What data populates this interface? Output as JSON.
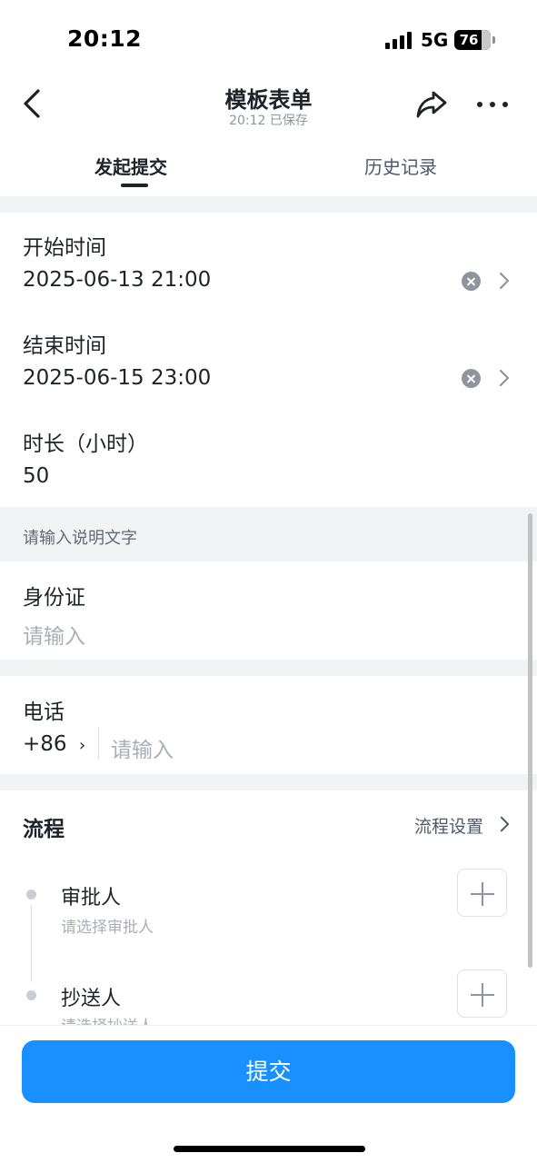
{
  "status_bar": {
    "time": "20:12",
    "network": "5G",
    "battery": "76"
  },
  "nav": {
    "title": "模板表单",
    "subtitle": "20:12 已保存"
  },
  "tabs": [
    {
      "label": "发起提交",
      "active": true
    },
    {
      "label": "历史记录",
      "active": false
    }
  ],
  "form": {
    "start_time": {
      "label": "开始时间",
      "value": "2025-06-13 21:00"
    },
    "end_time": {
      "label": "结束时间",
      "value": "2025-06-15 23:00"
    },
    "duration": {
      "label": "时长（小时）",
      "value": "50"
    },
    "description": "请输入说明文字",
    "id_card": {
      "label": "身份证",
      "placeholder": "请输入"
    },
    "phone": {
      "label": "电话",
      "country_code": "+86",
      "chevron": "›",
      "placeholder": "请输入"
    }
  },
  "process": {
    "title": "流程",
    "settings_label": "流程设置",
    "nodes": [
      {
        "title": "审批人",
        "subtitle": "请选择审批人"
      },
      {
        "title": "抄送人",
        "subtitle": "请选择抄送人"
      }
    ]
  },
  "submit_label": "提交",
  "colors": {
    "accent": "#1890ff",
    "background_gap": "#f2f3f5",
    "placeholder": "#a9aeb8"
  }
}
